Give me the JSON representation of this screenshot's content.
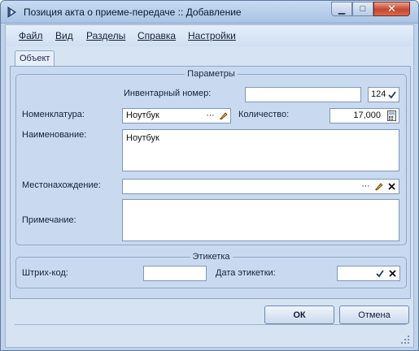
{
  "window": {
    "title": "Позиция акта о приеме-передаче :: Добавление",
    "minimize_label": "▁",
    "maximize_label": "□",
    "close_label": "✕"
  },
  "menu": {
    "items": [
      "Файл",
      "Вид",
      "Разделы",
      "Справка",
      "Настройки"
    ]
  },
  "tabs": [
    "Объект"
  ],
  "parameters": {
    "group_title": "Параметры",
    "inventory_label": "Инвентарный номер:",
    "inventory_value": "",
    "inventory_extra_value": "124",
    "nomenclature_label": "Номенклатура:",
    "nomenclature_value": "Ноутбук",
    "quantity_label": "Количество:",
    "quantity_value": "17,000",
    "name_label": "Наименование:",
    "name_value": "Ноутбук",
    "location_label": "Местонахождение:",
    "location_value": "",
    "note_label": "Примечание:",
    "note_value": ""
  },
  "label_group": {
    "group_title": "Этикетка",
    "barcode_label": "Штрих-код:",
    "barcode_value": "",
    "label_date_label": "Дата этикетки:",
    "label_date_value": ""
  },
  "buttons": {
    "ok": "ОК",
    "cancel": "Отмена"
  },
  "colors": {
    "accent": "#2c5ea8",
    "client_background": "#d6e3f3",
    "close_button": "#c5462e"
  }
}
